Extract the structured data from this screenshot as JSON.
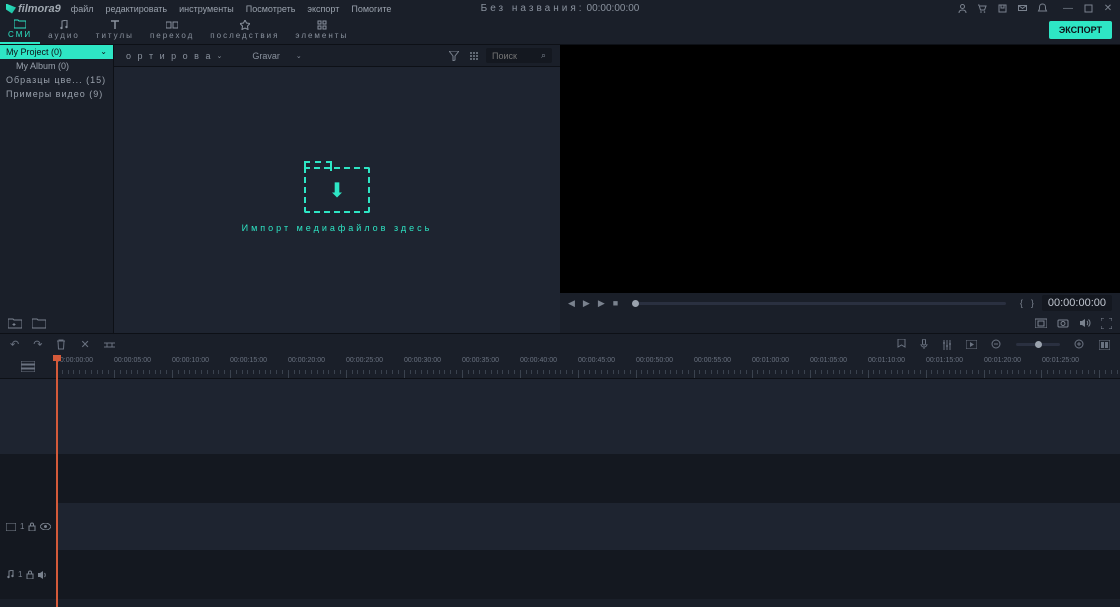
{
  "app": {
    "name": "filmora9"
  },
  "menu": {
    "file": "файл",
    "edit": "редактировать",
    "tools": "инструменты",
    "view": "Посмотреть",
    "export": "экспорт",
    "help": "Помогите"
  },
  "title": {
    "name": "Без названия",
    "sep": ":",
    "time": "00:00:00:00"
  },
  "tabs": {
    "media": "СМИ",
    "audio": "аудио",
    "titles": "титулы",
    "transition": "переход",
    "effects": "последствия",
    "elements": "элементы",
    "export_btn": "ЭКСПОРТ"
  },
  "sidebar": {
    "myproject": "My Project (0)",
    "myalbum": "My Album (0)",
    "samples": "Образцы цве... (15)",
    "examples": "Примеры видео (9)"
  },
  "media_toolbar": {
    "sort": "о р т и р о в а",
    "gravar": "Gravar"
  },
  "search": {
    "placeholder": "Поиск"
  },
  "import_zone": {
    "text": "Импорт медиафайлов здесь"
  },
  "preview": {
    "time": "00:00:00:00",
    "mark_in": "{",
    "mark_out": "}"
  },
  "timeline": {
    "ruler": [
      "00:00:00:00",
      "00:00:05:00",
      "00:00:10:00",
      "00:00:15:00",
      "00:00:20:00",
      "00:00:25:00",
      "00:00:30:00",
      "00:00:35:00",
      "00:00:40:00",
      "00:00:45:00",
      "00:00:50:00",
      "00:00:55:00",
      "00:01:00:00",
      "00:01:05:00",
      "00:01:10:00",
      "00:01:15:00",
      "00:01:20:00",
      "00:01:25:00"
    ],
    "video_track": "1",
    "audio_track": "1"
  }
}
